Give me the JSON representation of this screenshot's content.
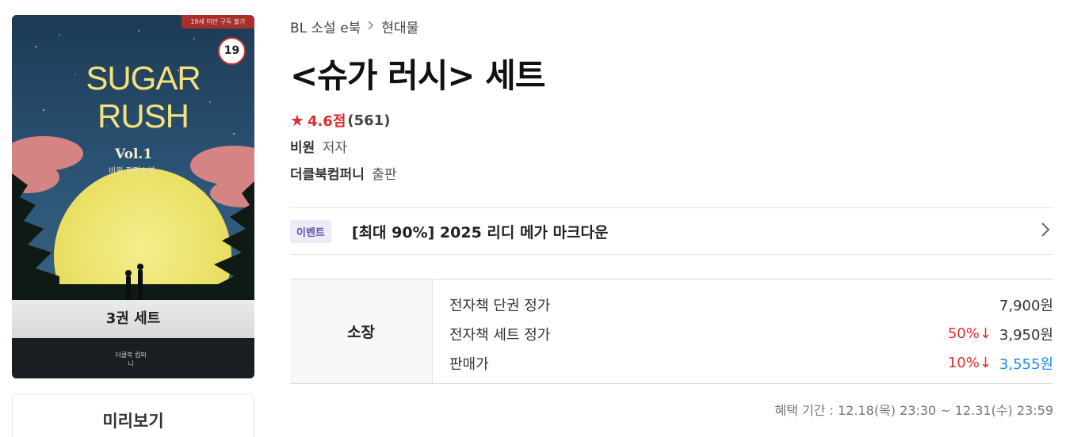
{
  "cover": {
    "age_banner": "19세 미만 구독 불가",
    "age_badge": "19",
    "title_line1": "SUGAR",
    "title_line2": "RUSH",
    "volume": "Vol.1",
    "author_line": "비원 장편소설",
    "set_label": "3권 세트",
    "publisher": "더클북 컴퍼니"
  },
  "preview_button": "미리보기",
  "breadcrumb": {
    "category": "BL 소설 e북",
    "separator_icon": "chevron-right-icon",
    "subcategory": "현대물"
  },
  "title": "<슈가 러시> 세트",
  "rating": {
    "score": "4.6점",
    "count": "(561)",
    "color": "#e02b2b"
  },
  "author": {
    "name": "비원",
    "role": "저자"
  },
  "publisher": {
    "name": "더클북컴퍼니",
    "role": "출판"
  },
  "event": {
    "tag": "이벤트",
    "text": "[최대 90%] 2025 리디 메가 마크다운"
  },
  "price": {
    "ownership_label": "소장",
    "rows": [
      {
        "label": "전자책 단권 정가",
        "discount": "",
        "value": "7,900원"
      },
      {
        "label": "전자책 세트 정가",
        "discount": "50%↓",
        "value": "3,950원"
      },
      {
        "label": "판매가",
        "discount": "10%↓",
        "value": "3,555원"
      }
    ],
    "discount_color": "#e03030",
    "sale_color": "#1e8cf0"
  },
  "benefit_period": "혜택 기간 : 12.18(목) 23:30 ~ 12.31(수) 23:59"
}
